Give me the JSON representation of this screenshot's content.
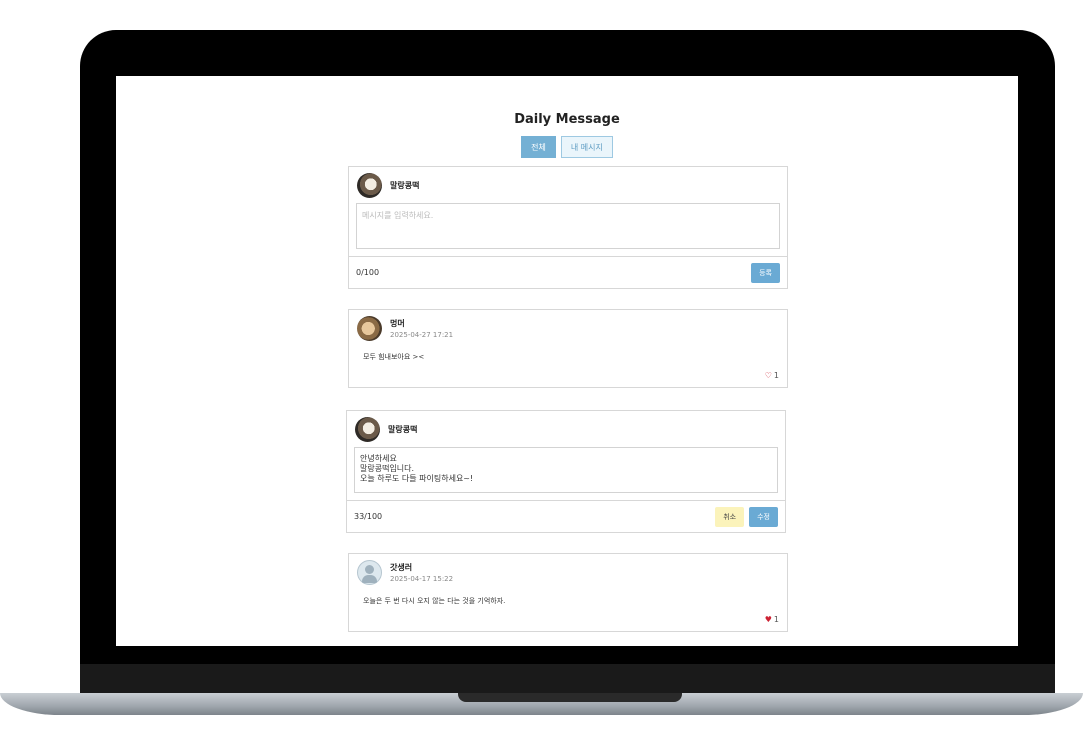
{
  "app": {
    "title": "Daily Message",
    "tabs": [
      {
        "label": "전체",
        "active": true
      },
      {
        "label": "내 메시지",
        "active": false
      }
    ],
    "accent_color": "#74b0d4"
  },
  "composer": {
    "nickname": "말랑콩떡",
    "placeholder": "메시지를 입력하세요.",
    "count": "0/100",
    "submit_label": "등록"
  },
  "messages": [
    {
      "nickname": "멍머",
      "date": "2025-04-27 17:21",
      "text": "모두 힘내보아요 ><",
      "likes": "1",
      "heart": "♡"
    },
    {
      "nickname": "말랑콩떡",
      "edit_text": "안녕하세요\n말랑콩떡입니다.\n오늘 하루도 다들 파이팅하세요~!",
      "count": "33/100",
      "cancel_label": "취소",
      "save_label": "수정"
    },
    {
      "nickname": "갓생러",
      "date": "2025-04-17 15:22",
      "text": "오늘은 두 번 다시 오지 않는 다는 것을 기억하자.",
      "likes": "1",
      "heart": "♥"
    }
  ]
}
